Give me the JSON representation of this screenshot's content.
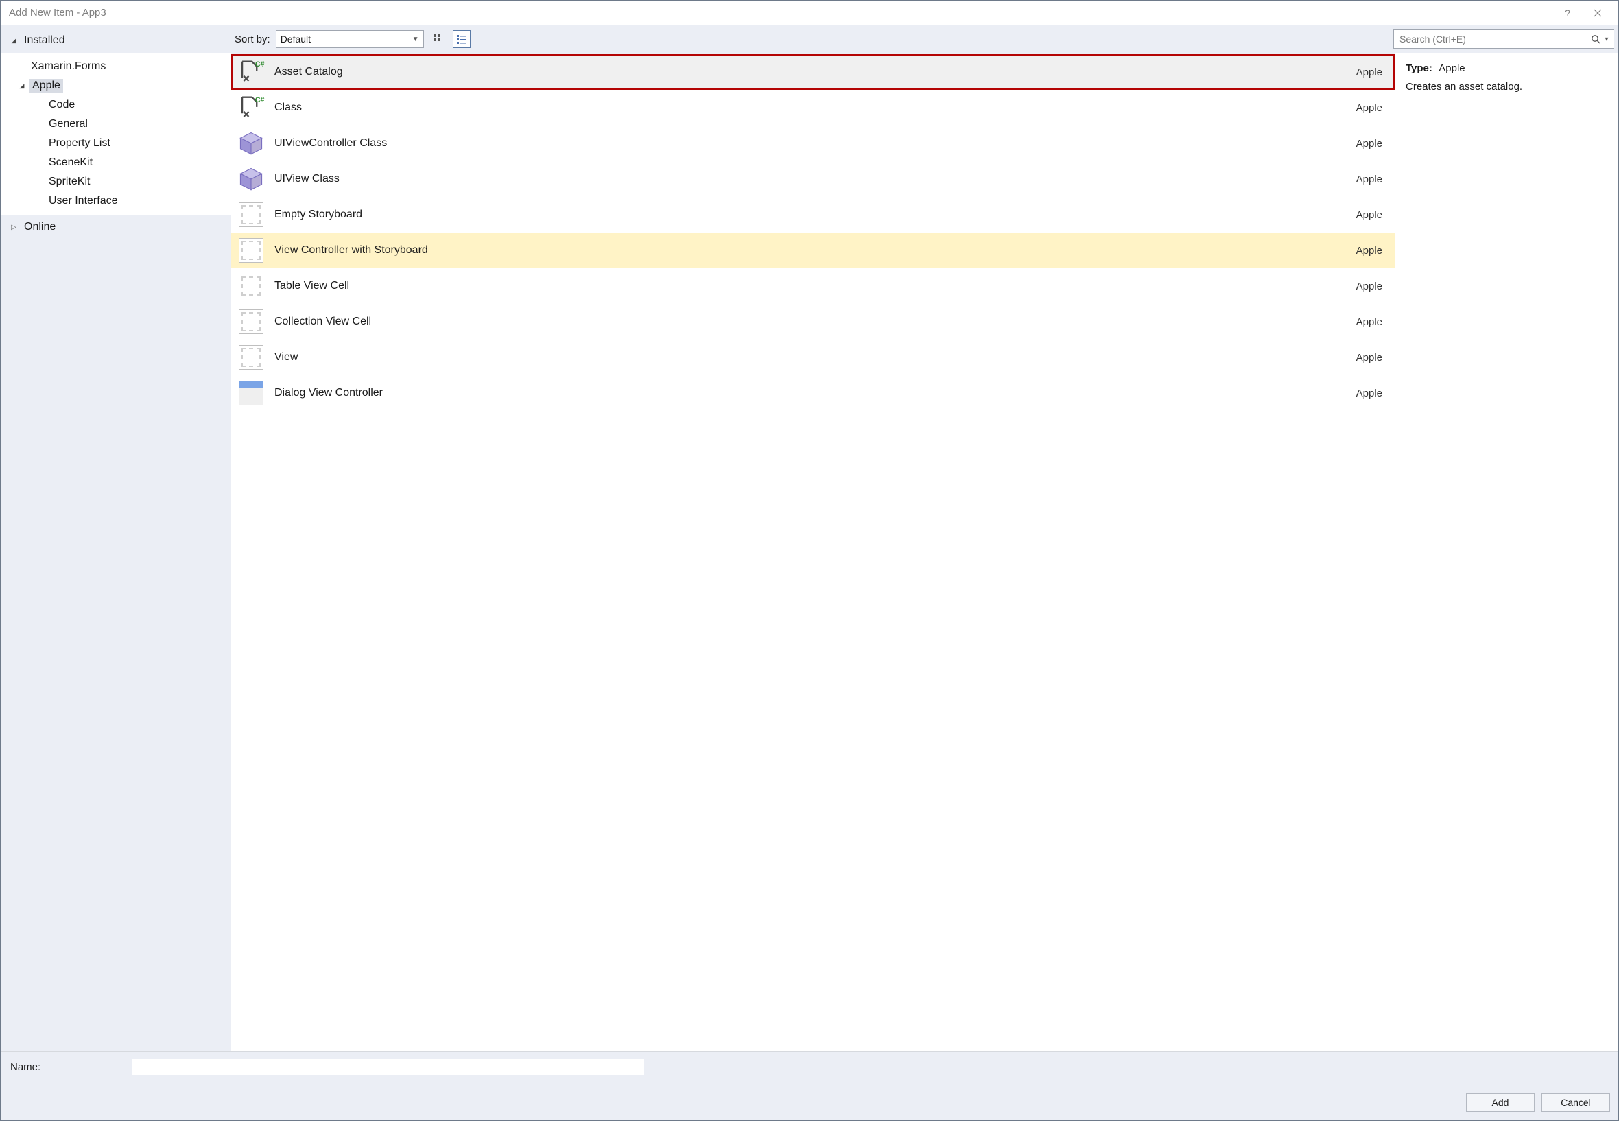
{
  "window": {
    "title": "Add New Item - App3"
  },
  "sidebar": {
    "installed_label": "Installed",
    "online_label": "Online",
    "items": [
      {
        "label": "Xamarin.Forms"
      },
      {
        "label": "Apple"
      }
    ],
    "apple_children": [
      {
        "label": "Code"
      },
      {
        "label": "General"
      },
      {
        "label": "Property List"
      },
      {
        "label": "SceneKit"
      },
      {
        "label": "SpriteKit"
      },
      {
        "label": "User Interface"
      }
    ]
  },
  "toolbar": {
    "sort_label": "Sort by:",
    "sort_value": "Default",
    "search_placeholder": "Search (Ctrl+E)"
  },
  "templates": [
    {
      "name": "Asset Catalog",
      "group": "Apple",
      "icon": "csharp-asset",
      "state": "selected"
    },
    {
      "name": "Class",
      "group": "Apple",
      "icon": "csharp-class"
    },
    {
      "name": "UIViewController Class",
      "group": "Apple",
      "icon": "cube"
    },
    {
      "name": "UIView Class",
      "group": "Apple",
      "icon": "cube"
    },
    {
      "name": "Empty Storyboard",
      "group": "Apple",
      "icon": "storyboard"
    },
    {
      "name": "View Controller with Storyboard",
      "group": "Apple",
      "icon": "storyboard",
      "state": "highlighted"
    },
    {
      "name": "Table View Cell",
      "group": "Apple",
      "icon": "storyboard"
    },
    {
      "name": "Collection View Cell",
      "group": "Apple",
      "icon": "storyboard"
    },
    {
      "name": "View",
      "group": "Apple",
      "icon": "storyboard"
    },
    {
      "name": "Dialog View Controller",
      "group": "Apple",
      "icon": "dialog"
    }
  ],
  "details": {
    "type_label": "Type:",
    "type_value": "Apple",
    "description": "Creates an asset catalog."
  },
  "bottom": {
    "name_label": "Name:",
    "name_value": "",
    "add_label": "Add",
    "cancel_label": "Cancel"
  }
}
